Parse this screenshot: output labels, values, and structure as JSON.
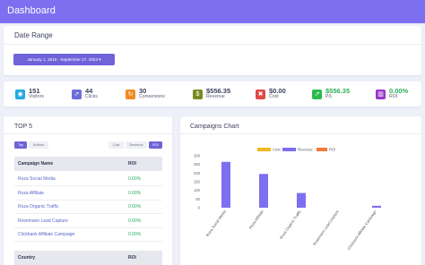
{
  "header": {
    "title": "Dashboard"
  },
  "date_range": {
    "title": "Date Range",
    "button_label": "January 1, 2010 - September 27, 2023 ▾"
  },
  "stats": [
    {
      "value": "151",
      "label": "Visitors",
      "icon": "eye-icon",
      "color": "#26a9e0",
      "glyph": "◉"
    },
    {
      "value": "44",
      "label": "Clicks",
      "icon": "cursor-icon",
      "color": "#6c6fd8",
      "glyph": "➚"
    },
    {
      "value": "30",
      "label": "Conversions",
      "icon": "refresh-icon",
      "color": "#f08a24",
      "glyph": "↻"
    },
    {
      "value": "$556.35",
      "label": "Revenue",
      "icon": "money-icon",
      "color": "#7a8a1f",
      "glyph": "$"
    },
    {
      "value": "$0.00",
      "label": "Cost",
      "icon": "cost-icon",
      "color": "#e04848",
      "glyph": "✖"
    },
    {
      "value": "$556.35",
      "label": "P/L",
      "icon": "chart-up-icon",
      "color": "#2dbb4e",
      "glyph": "↗",
      "value_color": "#2cae5a"
    },
    {
      "value": "0.00%",
      "label": "ROI",
      "icon": "bar-chart-icon",
      "color": "#9a35c7",
      "glyph": "▥",
      "value_color": "#2cae5a"
    }
  ],
  "top5": {
    "title": "TOP 5",
    "sort_tabs": [
      "Top",
      "Bottom"
    ],
    "metric_tabs": [
      "Cost",
      "Revenue",
      "ROI"
    ],
    "active_sort": "Top",
    "active_metric": "ROI",
    "campaign_table": {
      "headers": [
        "Campaign Name",
        "ROI"
      ],
      "rows": [
        {
          "name": "Roza Social Media",
          "roi": "0.00%"
        },
        {
          "name": "Roza Affiliate",
          "roi": "0.00%"
        },
        {
          "name": "Roza Organic Traffic",
          "roi": "0.00%"
        },
        {
          "name": "Rosemann Lead Capture",
          "roi": "0.00%"
        },
        {
          "name": "Clickbank Affiliate Campaign",
          "roi": "0.00%"
        }
      ]
    },
    "country_table": {
      "headers": [
        "Country",
        "ROI"
      ]
    }
  },
  "chart_panel": {
    "title": "Campaigns Chart"
  },
  "chart_data": {
    "type": "bar",
    "categories": [
      "Roza Social Media",
      "Roza Affiliate",
      "Roza Organic Traffic",
      "Rosemann Lead Capture",
      "Clickbank Affiliate Campaign"
    ],
    "series": [
      {
        "name": "Cost",
        "values": [
          0,
          0,
          0,
          0,
          0
        ],
        "color": "#f2b824"
      },
      {
        "name": "Revenue",
        "values": [
          265,
          195,
          85,
          0,
          11
        ],
        "color": "#7c6ff0"
      },
      {
        "name": "ROI",
        "values": [
          0,
          0,
          0,
          0,
          0
        ],
        "color": "#f07a3a"
      }
    ],
    "ylim": [
      0,
      300
    ],
    "yticks": [
      "0",
      "50",
      "100",
      "150",
      "200",
      "250",
      "300"
    ],
    "legend": "top",
    "grid": false
  }
}
